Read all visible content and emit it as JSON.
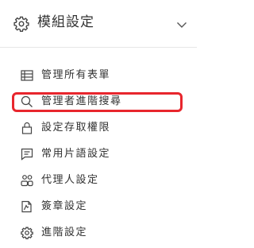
{
  "header": {
    "title": "模組設定",
    "icon": "gear-icon",
    "toggle_icon": "chevron-down-icon"
  },
  "menu": {
    "items": [
      {
        "label": "管理所有表單",
        "icon": "table-icon"
      },
      {
        "label": "管理者進階搜尋",
        "icon": "search-icon",
        "highlighted": true
      },
      {
        "label": "設定存取權限",
        "icon": "lock-icon"
      },
      {
        "label": "常用片語設定",
        "icon": "message-icon"
      },
      {
        "label": "代理人設定",
        "icon": "users-icon"
      },
      {
        "label": "簽章設定",
        "icon": "signature-icon"
      },
      {
        "label": "進階設定",
        "icon": "gear-icon"
      }
    ]
  },
  "colors": {
    "highlight": "#e8262d",
    "text": "#333333",
    "divider": "#e6e6e6"
  }
}
